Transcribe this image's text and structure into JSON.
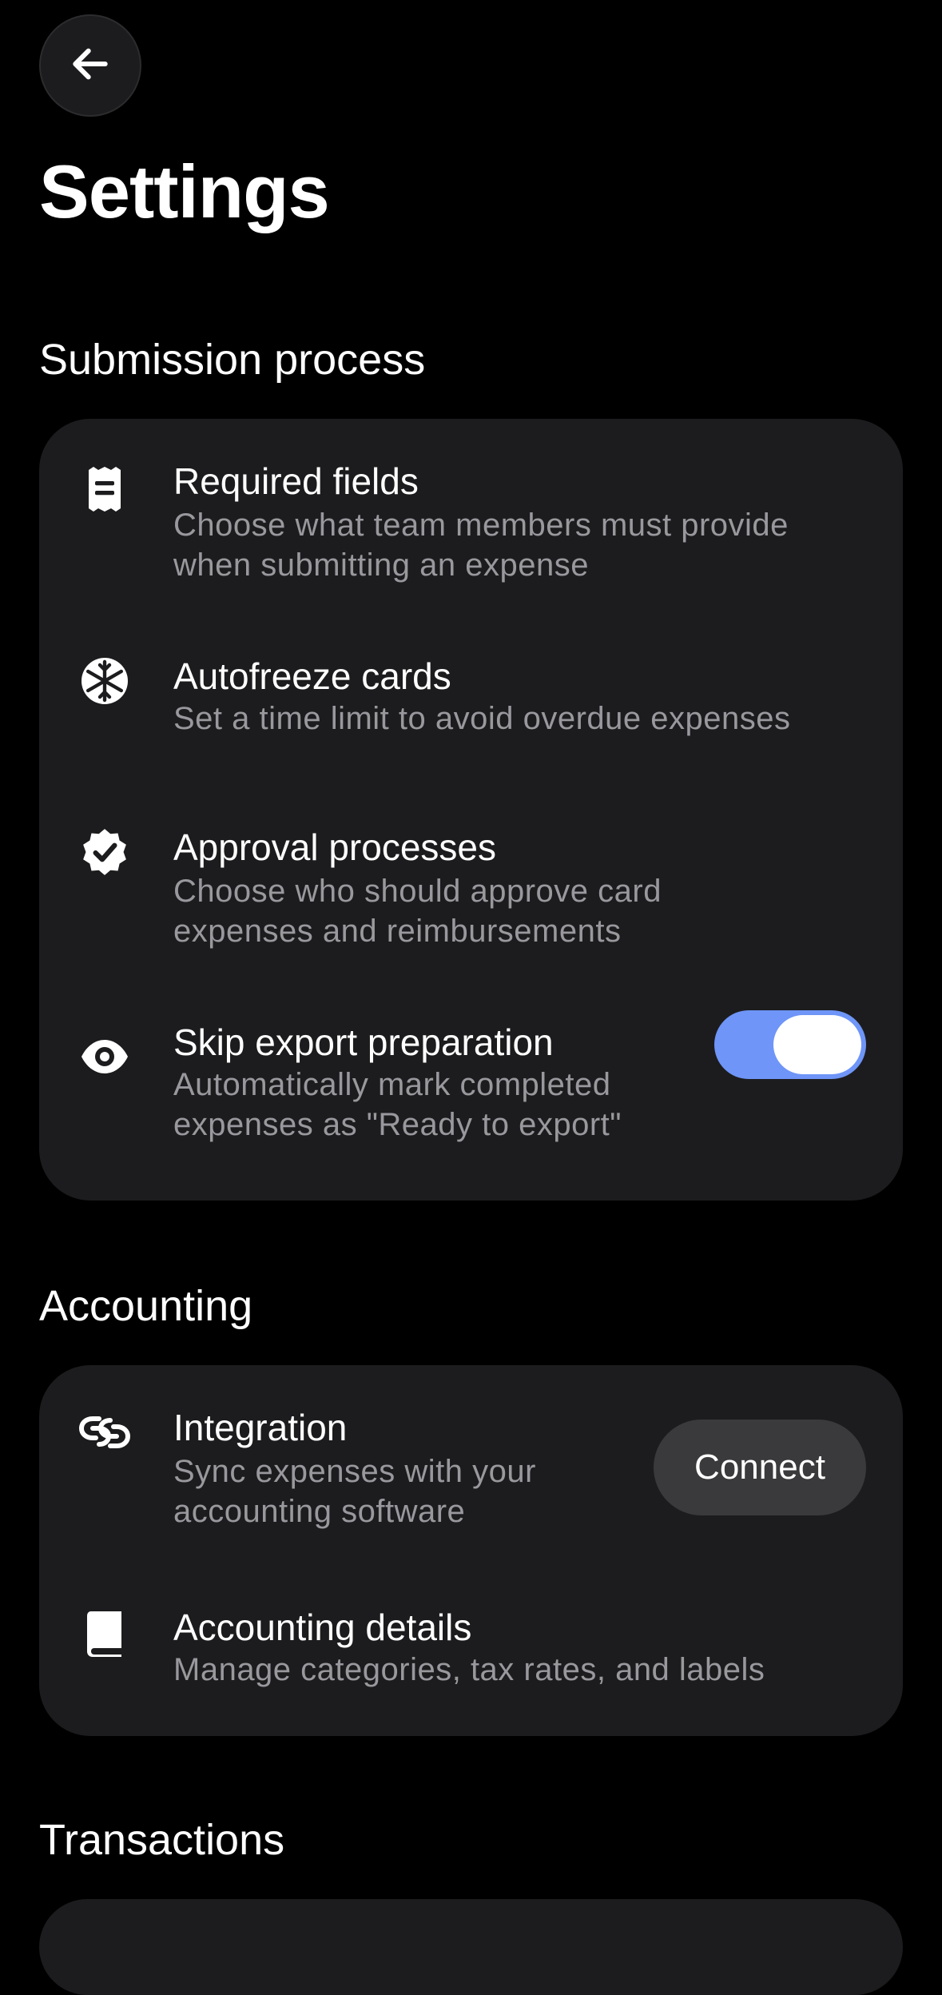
{
  "header": {
    "title": "Settings",
    "back_icon": "arrow-left-icon"
  },
  "colors": {
    "background": "#000000",
    "card": "#1c1c1e",
    "text_primary": "#ffffff",
    "text_secondary": "#98989d",
    "toggle_on": "#6e95f7",
    "button": "#3a3a3c"
  },
  "submission": {
    "title": "Submission process",
    "items": [
      {
        "icon": "receipt-icon",
        "title": "Required fields",
        "desc_line1": "Choose what team members must provide",
        "desc_line2": "when submitting an expense"
      },
      {
        "icon": "snowflake-icon",
        "title": "Autofreeze cards",
        "desc_line1": "Set a time limit to avoid overdue expenses"
      },
      {
        "icon": "verified-badge-icon",
        "title": "Approval processes",
        "desc_line1": "Choose who should approve card",
        "desc_line2": "expenses and reimbursements"
      },
      {
        "icon": "eye-icon",
        "title": "Skip export preparation",
        "desc_line1": "Automatically mark completed",
        "desc_line2": "expenses as \"Ready to export\"",
        "toggle_on": true
      }
    ]
  },
  "accounting": {
    "title": "Accounting",
    "items": [
      {
        "icon": "link-icon",
        "title": "Integration",
        "desc_line1": "Sync expenses with your",
        "desc_line2": "accounting software",
        "button_label": "Connect"
      },
      {
        "icon": "book-icon",
        "title": "Accounting details",
        "desc_line1": "Manage categories, tax rates, and labels"
      }
    ]
  },
  "transactions": {
    "title": "Transactions"
  }
}
